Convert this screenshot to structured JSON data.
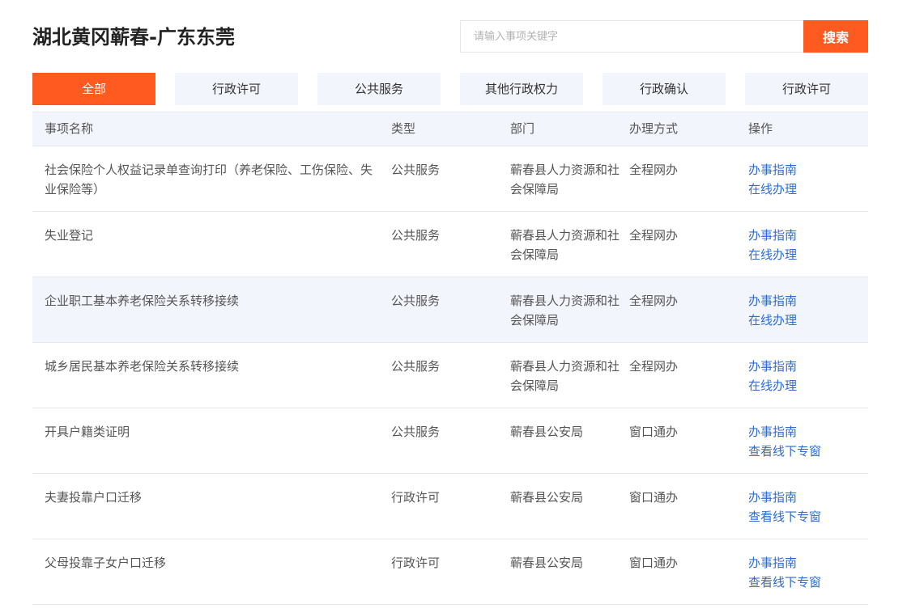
{
  "header": {
    "title": "湖北黄冈蕲春-广东东莞",
    "search_placeholder": "请输入事项关键字",
    "search_button": "搜索"
  },
  "tabs": [
    {
      "label": "全部",
      "active": true
    },
    {
      "label": "行政许可",
      "active": false
    },
    {
      "label": "公共服务",
      "active": false
    },
    {
      "label": "其他行政权力",
      "active": false
    },
    {
      "label": "行政确认",
      "active": false
    },
    {
      "label": "行政许可",
      "active": false
    }
  ],
  "table": {
    "headers": [
      "事项名称",
      "类型",
      "部门",
      "办理方式",
      "操作"
    ],
    "rows": [
      {
        "name": "社会保险个人权益记录单查询打印（养老保险、工伤保险、失业保险等）",
        "type": "公共服务",
        "dept": "蕲春县人力资源和社会保障局",
        "mode": "全程网办",
        "ops": [
          "办事指南",
          "在线办理"
        ]
      },
      {
        "name": "失业登记",
        "type": "公共服务",
        "dept": "蕲春县人力资源和社会保障局",
        "mode": "全程网办",
        "ops": [
          "办事指南",
          "在线办理"
        ]
      },
      {
        "name": "企业职工基本养老保险关系转移接续",
        "type": "公共服务",
        "dept": "蕲春县人力资源和社会保障局",
        "mode": "全程网办",
        "ops": [
          "办事指南",
          "在线办理"
        ]
      },
      {
        "name": "城乡居民基本养老保险关系转移接续",
        "type": "公共服务",
        "dept": "蕲春县人力资源和社会保障局",
        "mode": "全程网办",
        "ops": [
          "办事指南",
          "在线办理"
        ]
      },
      {
        "name": "开具户籍类证明",
        "type": "公共服务",
        "dept": "蕲春县公安局",
        "mode": "窗口通办",
        "ops": [
          "办事指南",
          "查看线下专窗"
        ]
      },
      {
        "name": "夫妻投靠户口迁移",
        "type": "行政许可",
        "dept": "蕲春县公安局",
        "mode": "窗口通办",
        "ops": [
          "办事指南",
          "查看线下专窗"
        ]
      },
      {
        "name": "父母投靠子女户口迁移",
        "type": "行政许可",
        "dept": "蕲春县公安局",
        "mode": "窗口通办",
        "ops": [
          "办事指南",
          "查看线下专窗"
        ]
      }
    ]
  },
  "colors": {
    "accent": "#ff5a1f",
    "tab_background": "#f2f5fb",
    "link": "#2f6ccf"
  }
}
